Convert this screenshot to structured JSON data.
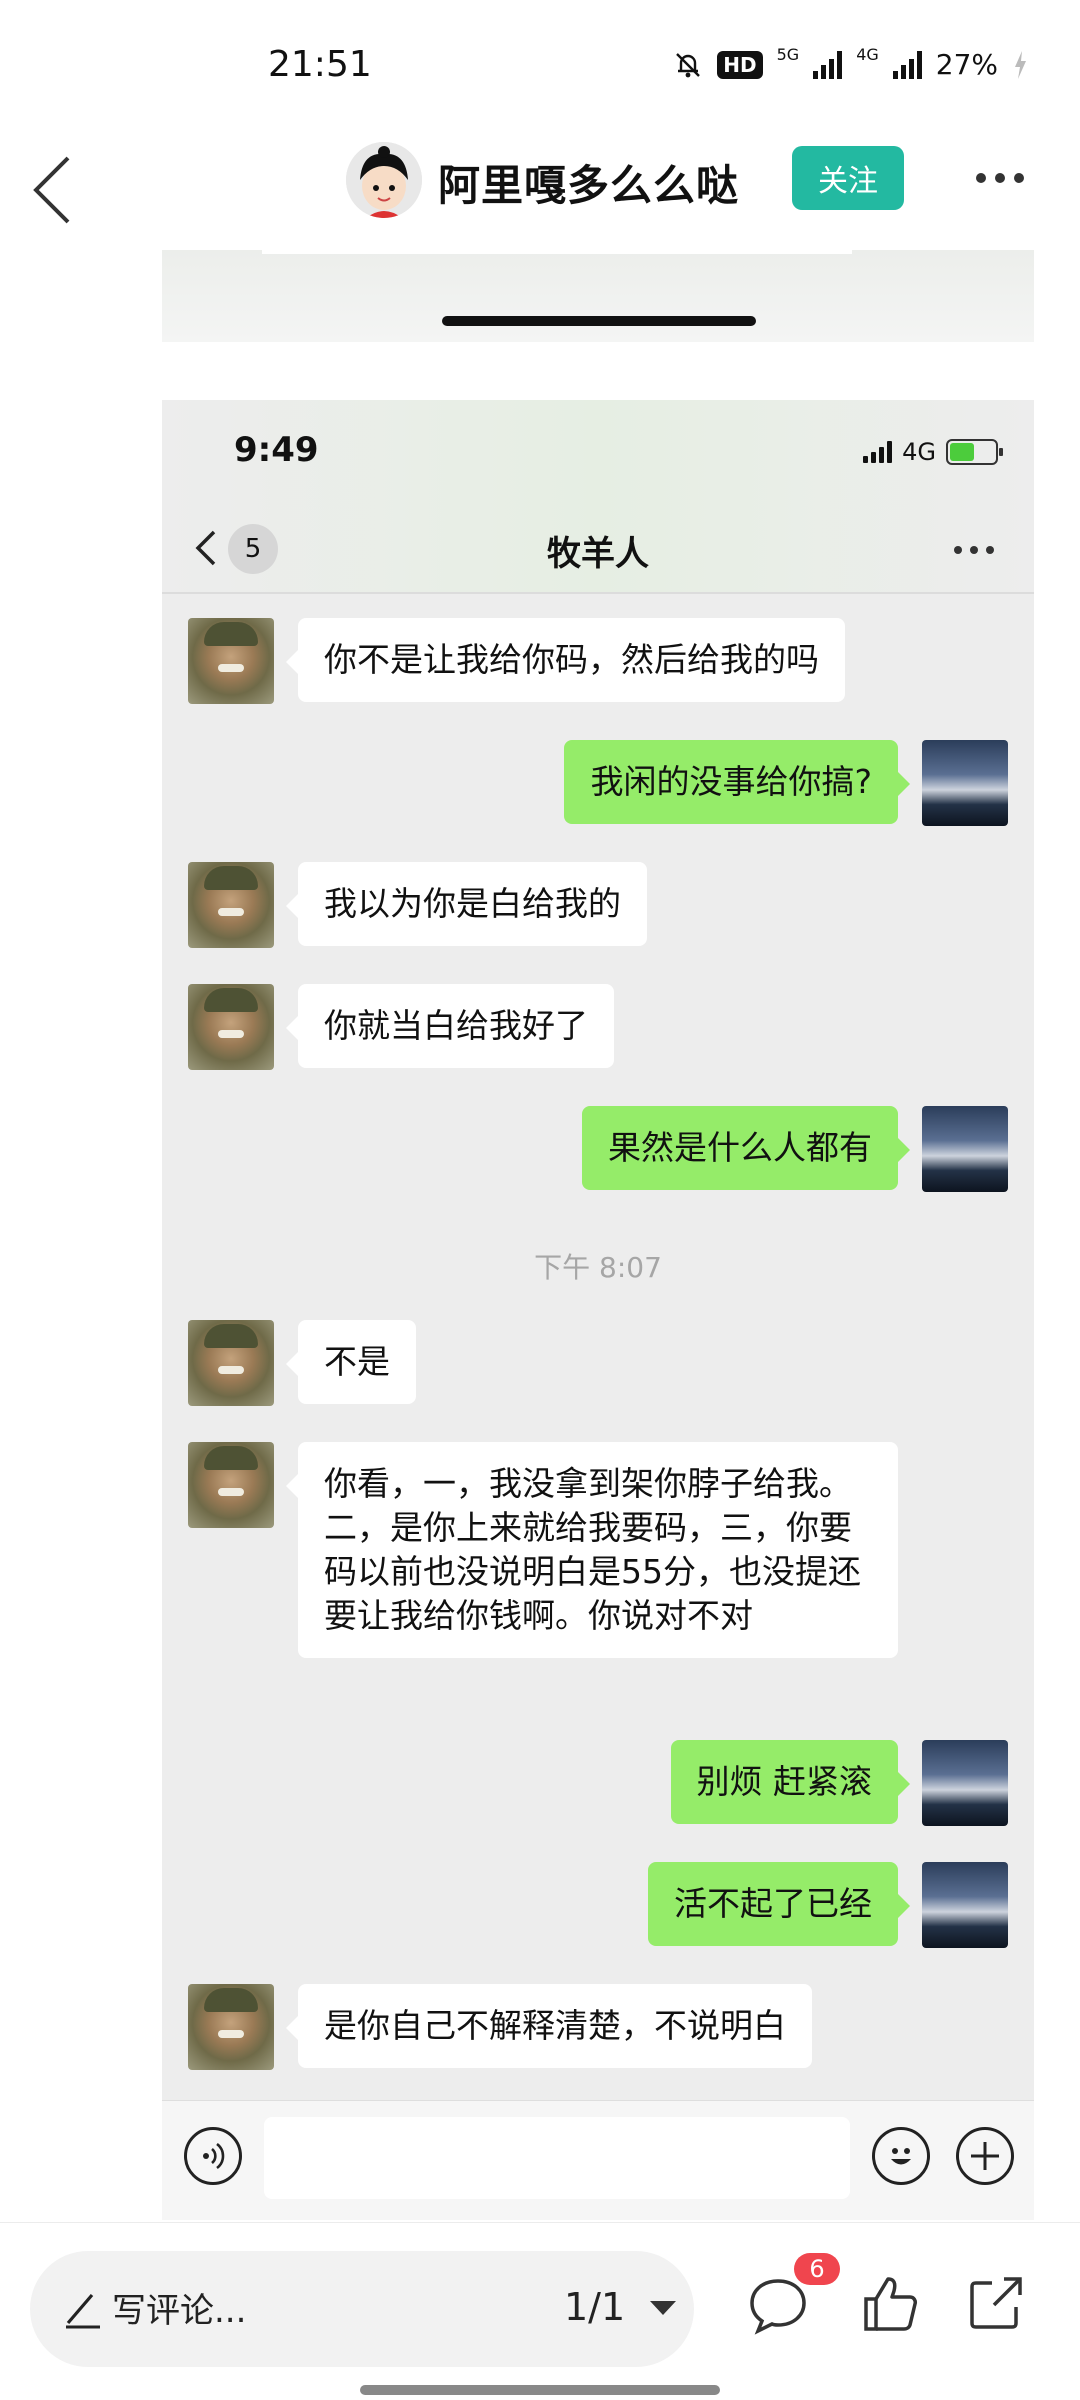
{
  "status_bar": {
    "time": "21:51",
    "hd": "HD",
    "net1": "5G",
    "net2": "4G",
    "battery": "27%"
  },
  "header": {
    "author": "阿里嘎多么么哒",
    "follow_label": "关注"
  },
  "screenshot": {
    "status_time": "9:49",
    "network": "4G",
    "unread_count": "5",
    "chat_title": "牧羊人",
    "messages": [
      {
        "side": "left",
        "text": "你不是让我给你码，然后给我的吗"
      },
      {
        "side": "right",
        "text": "我闲的没事给你搞?"
      },
      {
        "side": "left",
        "text": "我以为你是白给我的"
      },
      {
        "side": "left",
        "text": "你就当白给我好了"
      },
      {
        "side": "right",
        "text": "果然是什么人都有"
      },
      {
        "side": "left",
        "text": "不是"
      },
      {
        "side": "left",
        "text": "你看，一，我没拿到架你脖子给我。二，是你上来就给我要码，三，你要码以前也没说明白是55分，也没提还要让我给你钱啊。你说对不对"
      },
      {
        "side": "right",
        "text": "别烦 赶紧滚"
      },
      {
        "side": "right",
        "text": "活不起了已经"
      },
      {
        "side": "left",
        "text": "是你自己不解释清楚，不说明白"
      }
    ],
    "timestamp": "下午 8:07"
  },
  "bottom": {
    "comment_placeholder": "写评论...",
    "page_indicator": "1/1",
    "comment_count": "6"
  }
}
